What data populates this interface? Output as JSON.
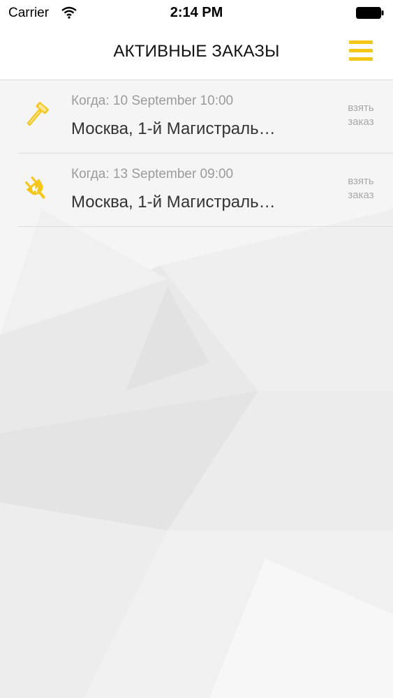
{
  "status_bar": {
    "carrier": "Carrier",
    "time": "2:14 PM"
  },
  "header": {
    "title": "АКТИВНЫЕ ЗАКАЗЫ",
    "menu_icon": "hamburger-menu-icon"
  },
  "orders": [
    {
      "icon": "hammer-icon",
      "when": "Когда: 10 September 10:00",
      "address": "Москва, 1-й Магистраль…",
      "action": "взять заказ"
    },
    {
      "icon": "electric-plug-icon",
      "when": "Когда: 13 September 09:00",
      "address": "Москва, 1-й Магистраль…",
      "action": "взять заказ"
    }
  ],
  "colors": {
    "accent": "#f5c518",
    "secondary_text": "#9b9b9b",
    "primary_text": "#333333",
    "background": "#f4f4f4"
  }
}
